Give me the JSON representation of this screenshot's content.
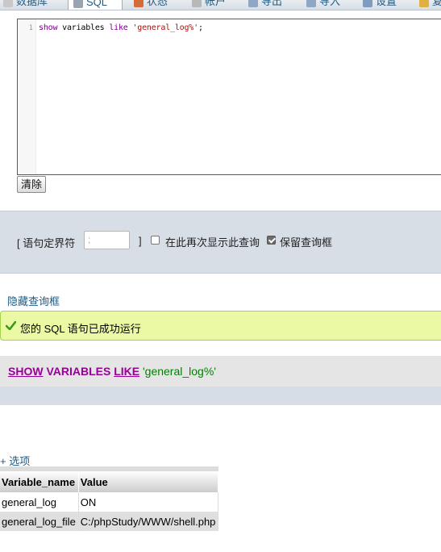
{
  "tabs": [
    {
      "label": "数据库",
      "icon": "database-icon"
    },
    {
      "label": "SQL",
      "icon": "sql-icon",
      "active": true
    },
    {
      "label": "状态",
      "icon": "status-icon"
    },
    {
      "label": "帐户",
      "icon": "accounts-icon"
    },
    {
      "label": "导出",
      "icon": "export-icon"
    },
    {
      "label": "导入",
      "icon": "import-icon"
    },
    {
      "label": "设置",
      "icon": "settings-icon"
    },
    {
      "label": "复制",
      "icon": "replication-icon"
    }
  ],
  "editor": {
    "line_number": "1",
    "code_kw1": "show",
    "code_plain1": " variables ",
    "code_kw2": "like",
    "code_plain2": " ",
    "code_str": "'general_log%'",
    "code_plain3": ";"
  },
  "clear_button": "清除",
  "delimiter": {
    "label": "[ 语句定界符",
    "value": ";",
    "bracket_end": "]",
    "show_again_label": "在此再次显示此查询",
    "show_again_checked": false,
    "retain_label": "保留查询框",
    "retain_checked": true
  },
  "hide_query_link": "隐藏查询框",
  "success_message": "您的 SQL 语句已成功运行",
  "sql_display": {
    "kw1": "SHOW",
    "kw2": "VARIABLES",
    "kw3": "LIKE",
    "str": "'general_log%'"
  },
  "options_link": "+ 选项",
  "result_table": {
    "headers": [
      "Variable_name",
      "Value"
    ],
    "rows": [
      [
        "general_log",
        "ON"
      ],
      [
        "general_log_file",
        "C:/phpStudy/WWW/shell.php"
      ]
    ]
  },
  "colors": {
    "link": "#235a81",
    "success_bg": "#ebf8a4",
    "sql_keyword": "#990099",
    "sql_string": "#008000"
  }
}
